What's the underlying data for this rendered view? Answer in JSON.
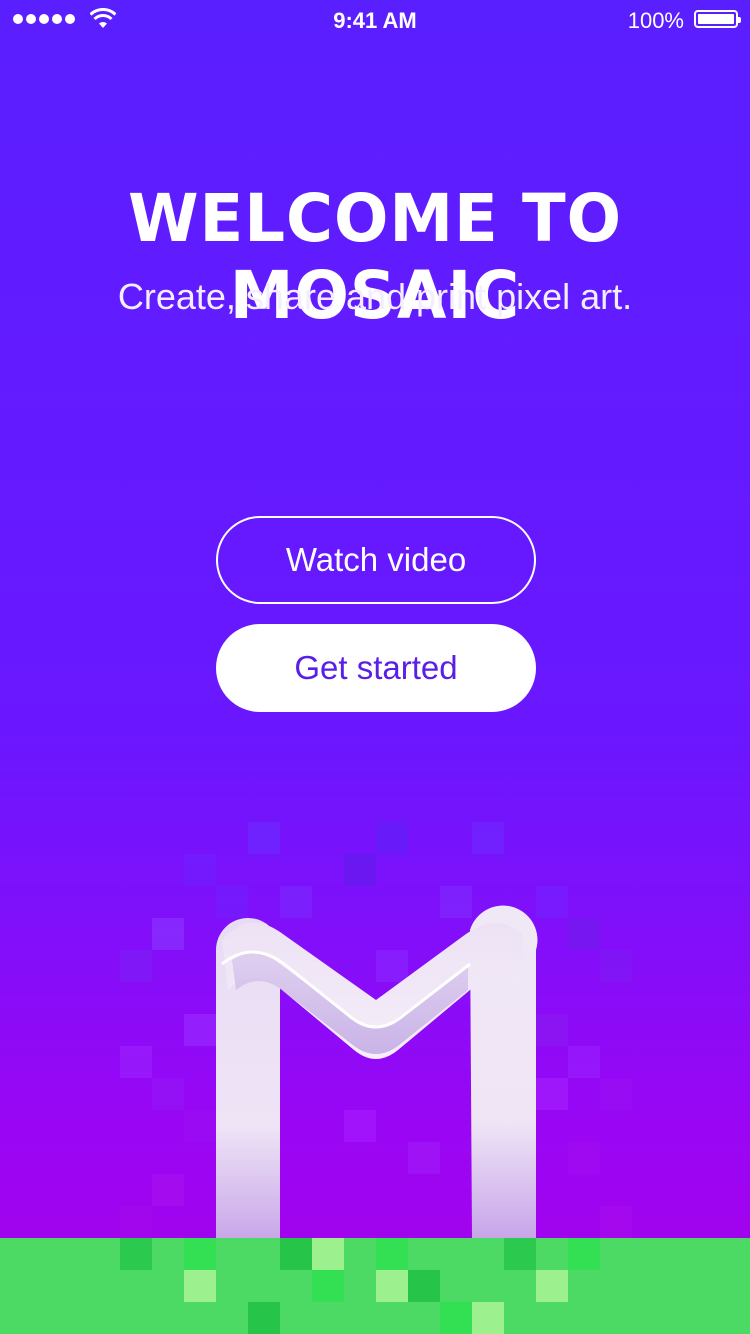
{
  "status_bar": {
    "time": "9:41 AM",
    "battery": "100%",
    "signal_bars": 5,
    "icons": [
      "signal-dots-icon",
      "wifi-icon",
      "battery-icon"
    ]
  },
  "hero": {
    "title": "WELCOME TO MOSAIC",
    "subtitle": "Create, share and print pixel art."
  },
  "actions": {
    "watch_video": "Watch video",
    "get_started": "Get started"
  },
  "illustration": {
    "logo_icon": "mosaic-m-logo-icon",
    "ground": "pixel-grass"
  },
  "colors": {
    "background_top": "#5a1fff",
    "background_bottom": "#a103ee",
    "accent_text": "#5a1fe6",
    "grass": "#4cd964"
  }
}
